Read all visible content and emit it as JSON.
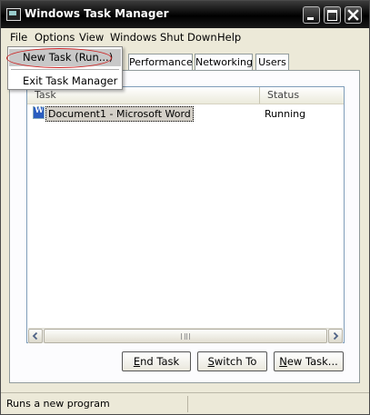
{
  "window": {
    "title": "Windows Task Manager"
  },
  "menu": [
    "File",
    "Options",
    "View",
    "Windows",
    "Shut Down",
    "Help"
  ],
  "file_menu": {
    "items": [
      "New Task (Run...)",
      "Exit Task Manager"
    ]
  },
  "tabs": [
    "Performance",
    "Networking",
    "Users"
  ],
  "list": {
    "columns": [
      "Task",
      "Status"
    ],
    "rows": [
      {
        "task": "Document1 - Microsoft Word",
        "status": "Running"
      }
    ]
  },
  "buttons": {
    "end_task": {
      "u": "E",
      "rest": "nd Task"
    },
    "switch_to": {
      "u": "S",
      "rest": "witch To"
    },
    "new_task": {
      "u": "N",
      "rest": "ew Task..."
    }
  },
  "statusbar": {
    "text": "Runs a new program"
  },
  "colors": {
    "title_bar": "#000000",
    "annotation": "#cc2222",
    "selection": "#c8c8c8"
  },
  "icons": [
    "task-manager-icon",
    "minimize-icon",
    "maximize-icon",
    "close-icon",
    "word-document-icon",
    "arrow-left-icon",
    "arrow-right-icon",
    "scroll-grip-icon"
  ]
}
